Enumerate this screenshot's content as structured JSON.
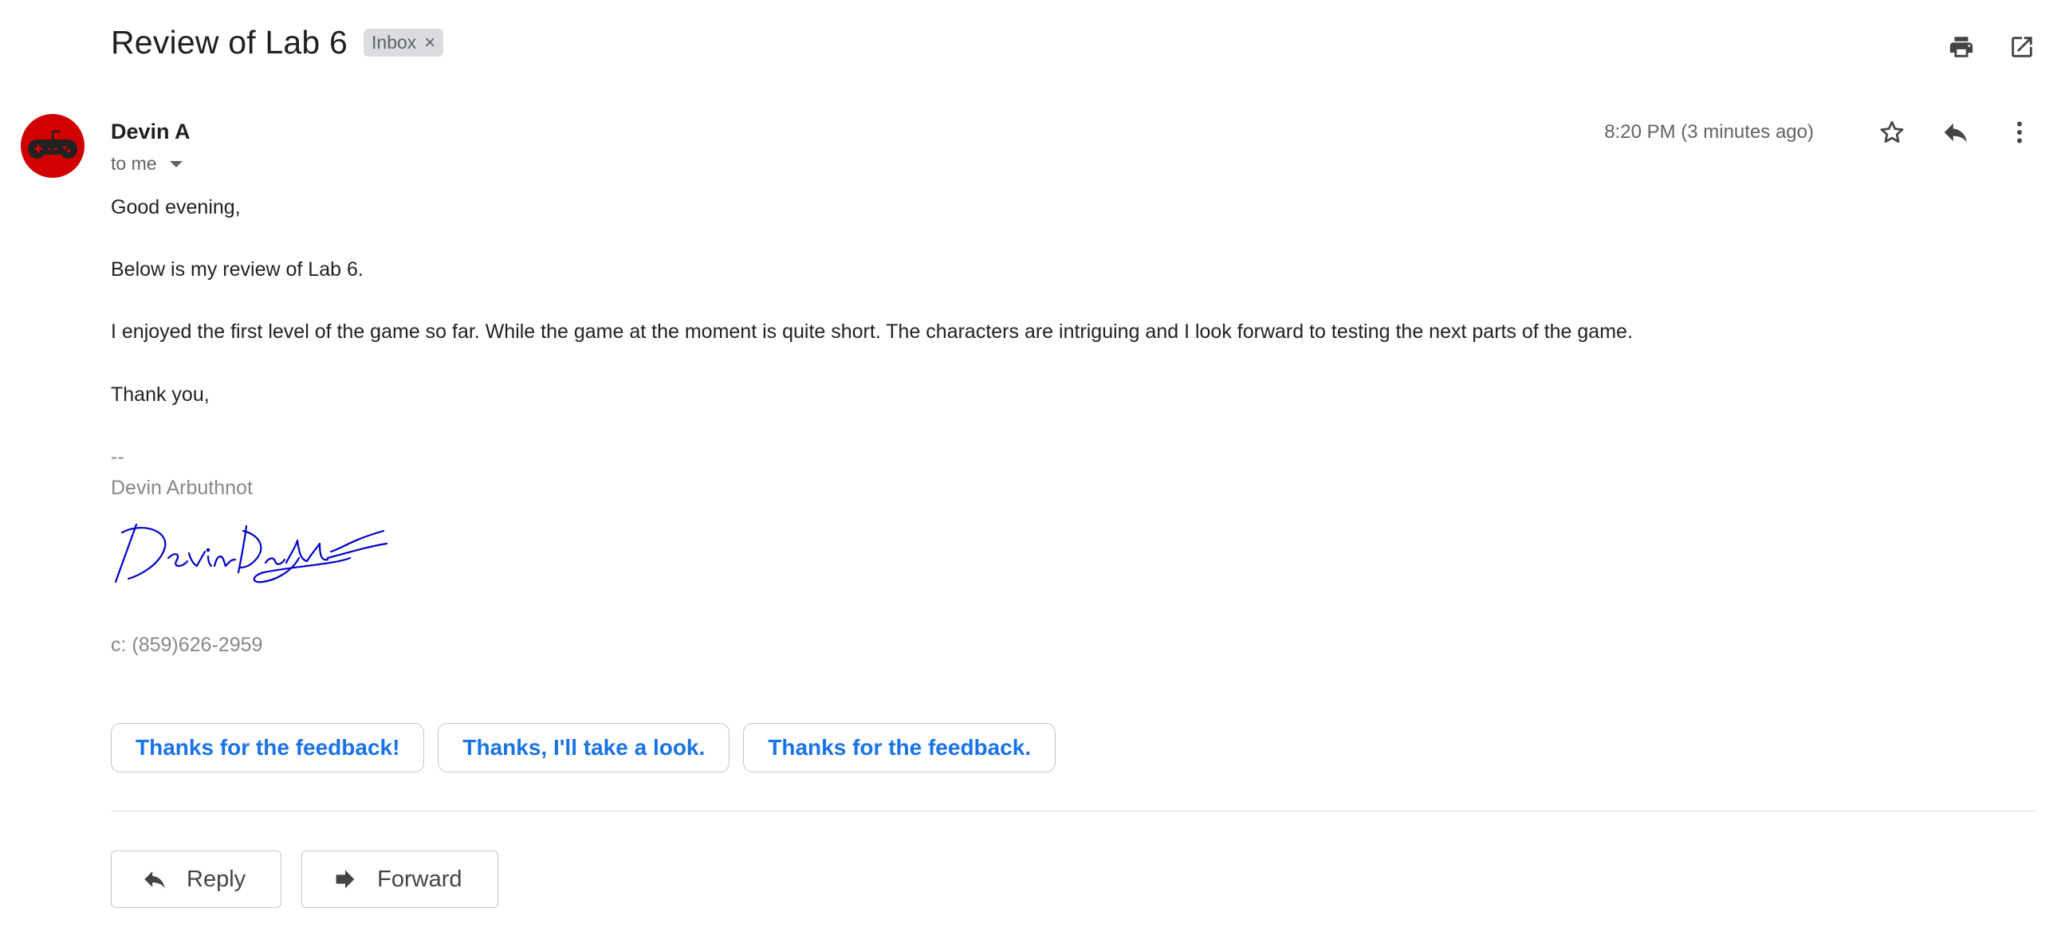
{
  "email": {
    "subject": "Review of Lab 6",
    "label": "Inbox",
    "label_close": "×",
    "sender": "Devin A",
    "recipient": "to me",
    "timestamp": "8:20 PM (3 minutes ago)",
    "body": {
      "greeting": "Good evening,",
      "line1": "Below is my review of Lab 6.",
      "line2": "I enjoyed the first level of the game so far. While the game at the moment is quite short. The characters are intriguing and I look forward to testing the next parts of the game.",
      "closing": "Thank you,"
    },
    "signature": {
      "separator": "--",
      "name": "Devin Arbuthnot",
      "phone": "c: (859)626-2959",
      "handwritten": "Devin Arbuthnot"
    }
  },
  "smart_replies": [
    "Thanks for the feedback!",
    "Thanks, I'll take a look.",
    "Thanks for the feedback."
  ],
  "actions": {
    "reply_label": "Reply",
    "forward_label": "Forward"
  },
  "icons": [
    "print-icon",
    "open-in-new-window-icon",
    "star-icon",
    "reply-icon",
    "more-vert-icon",
    "gamepad-icon",
    "forward-icon"
  ],
  "colors": {
    "accent": "#1a73e8",
    "avatar_bg": "#d00000",
    "signature_ink": "#0000cc",
    "chip_bg": "#dadce0"
  }
}
